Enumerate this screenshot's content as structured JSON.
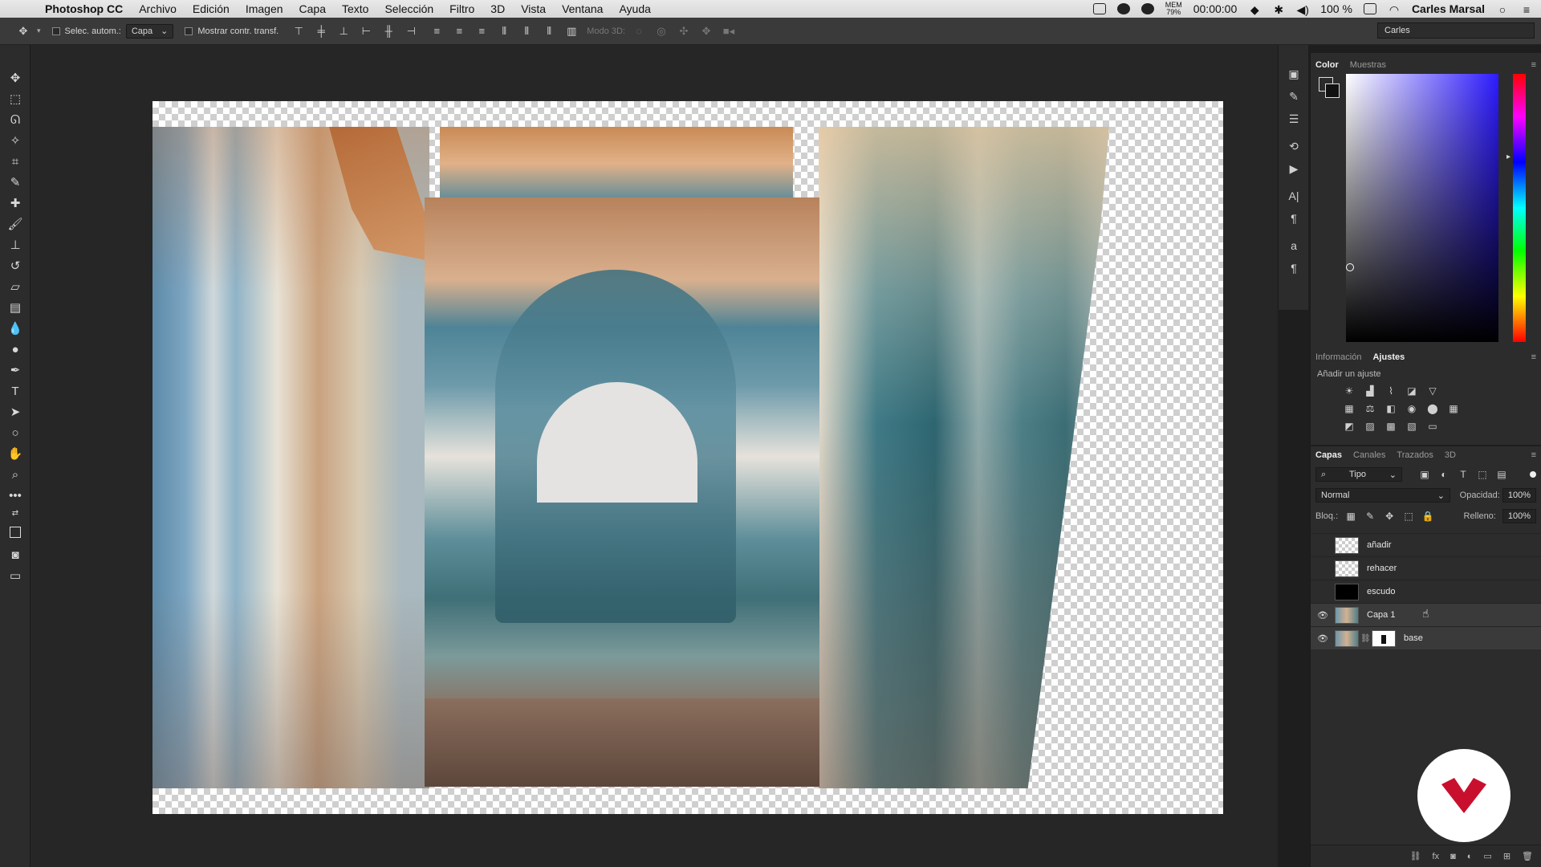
{
  "menubar": {
    "app_name": "Photoshop CC",
    "items": [
      "Archivo",
      "Edición",
      "Imagen",
      "Capa",
      "Texto",
      "Selección",
      "Filtro",
      "3D",
      "Vista",
      "Ventana",
      "Ayuda"
    ],
    "status": {
      "mem_label": "MEM",
      "mem_value": "79%",
      "timer": "00:00:00",
      "battery": "100 %",
      "user": "Carles Marsal"
    }
  },
  "options_bar": {
    "auto_select_label": "Selec. autom.:",
    "auto_select_value": "Capa",
    "show_transform_label": "Mostrar contr. transf.",
    "mode_3d_label": "Modo 3D:",
    "workspace": "Carles"
  },
  "color_panel": {
    "tabs": [
      "Color",
      "Muestras"
    ],
    "active_tab": "Color",
    "foreground": "#2b2b2b",
    "background": "#111111",
    "hue_hex": "#2d1bff"
  },
  "adjustments_panel": {
    "tabs": [
      "Información",
      "Ajustes"
    ],
    "active_tab": "Ajustes",
    "title": "Añadir un ajuste"
  },
  "layers_panel": {
    "tabs": [
      "Capas",
      "Canales",
      "Trazados",
      "3D"
    ],
    "active_tab": "Capas",
    "filter_value": "Tipo",
    "blend_mode": "Normal",
    "opacity_label": "Opacidad:",
    "opacity_value": "100%",
    "lock_label": "Bloq.:",
    "fill_label": "Relleno:",
    "fill_value": "100%",
    "layers": [
      {
        "name": "añadir",
        "visible": false,
        "thumb": "transparent"
      },
      {
        "name": "rehacer",
        "visible": false,
        "thumb": "transparent"
      },
      {
        "name": "escudo",
        "visible": false,
        "thumb": "black"
      },
      {
        "name": "Capa 1",
        "visible": true,
        "thumb": "image"
      },
      {
        "name": "base",
        "visible": true,
        "thumb": "image+mask"
      }
    ]
  },
  "colors": {
    "brand_red": "#c8102e",
    "panel_bg": "#2c2c2c",
    "canvas_bg": "#262626"
  }
}
